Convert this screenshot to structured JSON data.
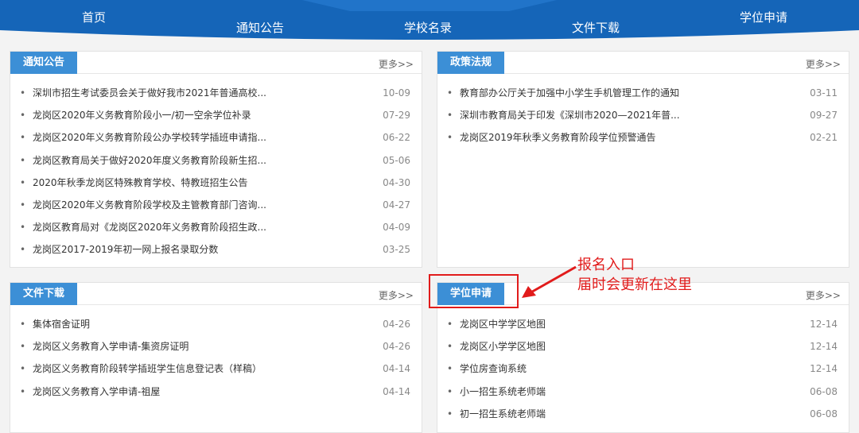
{
  "nav": {
    "items": [
      "首页",
      "通知公告",
      "学校名录",
      "文件下载",
      "学位申请"
    ]
  },
  "more_label": "更多>>",
  "panels": {
    "notice": {
      "title": "通知公告",
      "items": [
        {
          "text": "深圳市招生考试委员会关于做好我市2021年普通高校...",
          "date": "10-09"
        },
        {
          "text": "龙岗区2020年义务教育阶段小一/初一空余学位补录",
          "date": "07-29"
        },
        {
          "text": "龙岗区2020年义务教育阶段公办学校转学插班申请指...",
          "date": "06-22"
        },
        {
          "text": "龙岗区教育局关于做好2020年度义务教育阶段新生招...",
          "date": "05-06"
        },
        {
          "text": "2020年秋季龙岗区特殊教育学校、特教班招生公告",
          "date": "04-30"
        },
        {
          "text": "龙岗区2020年义务教育阶段学校及主管教育部门咨询...",
          "date": "04-27"
        },
        {
          "text": "龙岗区教育局对《龙岗区2020年义务教育阶段招生政...",
          "date": "04-09"
        },
        {
          "text": "龙岗区2017-2019年初一网上报名录取分数",
          "date": "03-25"
        }
      ]
    },
    "policy": {
      "title": "政策法规",
      "items": [
        {
          "text": "教育部办公厅关于加强中小学生手机管理工作的通知",
          "date": "03-11"
        },
        {
          "text": "深圳市教育局关于印发《深圳市2020—2021年普...",
          "date": "09-27"
        },
        {
          "text": "龙岗区2019年秋季义务教育阶段学位预警通告",
          "date": "02-21"
        }
      ]
    },
    "download": {
      "title": "文件下载",
      "items": [
        {
          "text": "集体宿舍证明",
          "date": "04-26"
        },
        {
          "text": "龙岗区义务教育入学申请-集资房证明",
          "date": "04-26"
        },
        {
          "text": "龙岗区义务教育阶段转学插班学生信息登记表（样稿）",
          "date": "04-14"
        },
        {
          "text": "龙岗区义务教育入学申请-祖屋",
          "date": "04-14"
        }
      ]
    },
    "apply": {
      "title": "学位申请",
      "items": [
        {
          "text": "龙岗区中学学区地图",
          "date": "12-14"
        },
        {
          "text": "龙岗区小学学区地图",
          "date": "12-14"
        },
        {
          "text": "学位房查询系统",
          "date": "12-14"
        },
        {
          "text": "小一招生系统老师端",
          "date": "06-08"
        },
        {
          "text": "初一招生系统老师端",
          "date": "06-08"
        }
      ]
    }
  },
  "annotation": {
    "line1": "报名入口",
    "line2": "届时会更新在这里",
    "color": "#e11b1b"
  },
  "colors": {
    "nav_blue": "#1565b8",
    "tab_blue": "#3c8fd6"
  }
}
